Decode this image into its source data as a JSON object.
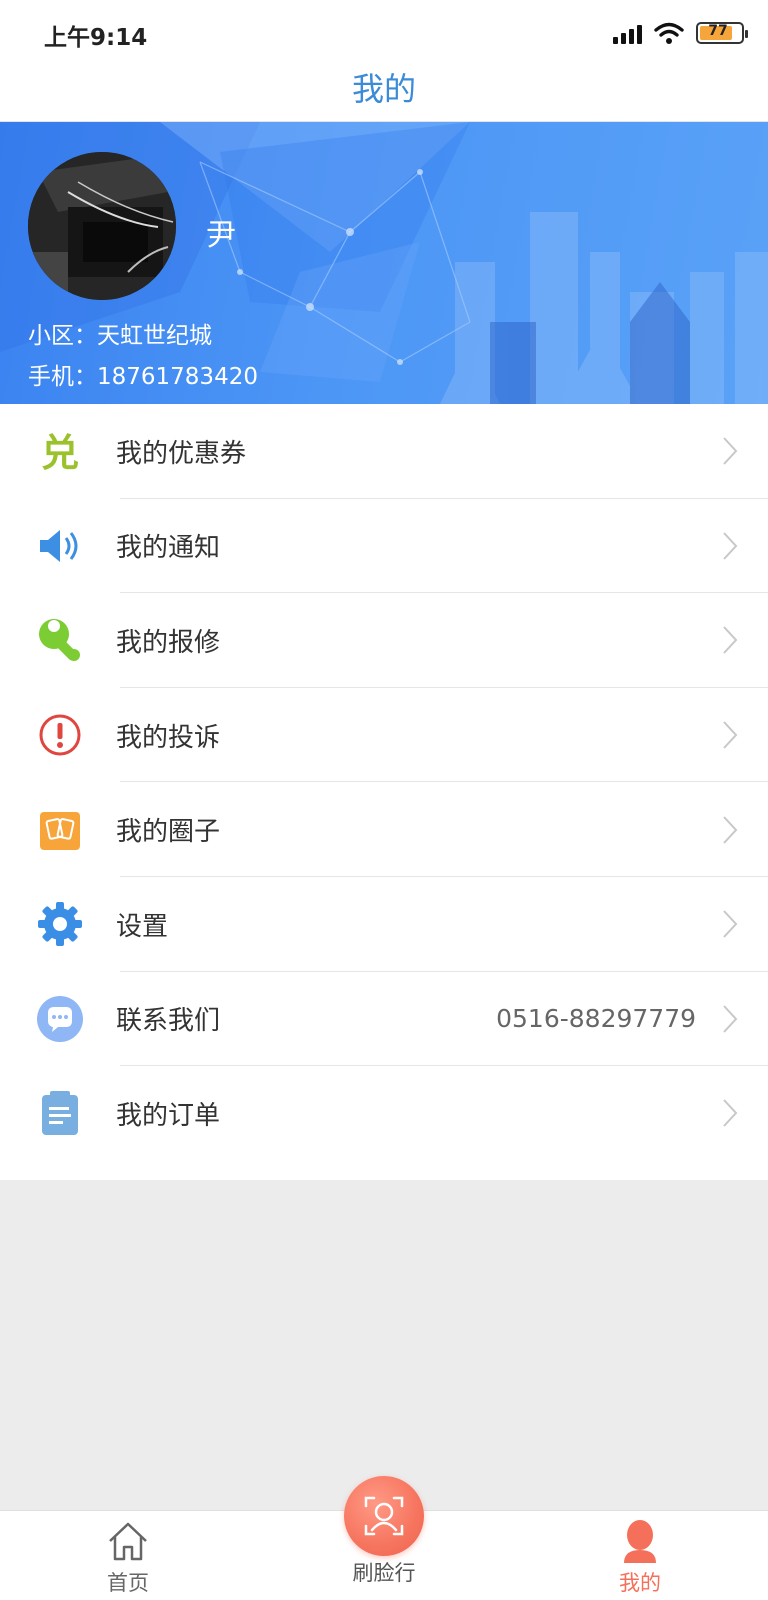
{
  "status_bar": {
    "time": "上午9:14",
    "battery": "77",
    "signal_icon": "signal-bars-icon",
    "wifi_icon": "wifi-icon"
  },
  "header": {
    "title": "我的"
  },
  "profile": {
    "name": "尹",
    "community": "小区：天虹世纪城",
    "phone": "手机：18761783420"
  },
  "menu": {
    "items": [
      {
        "label": "我的优惠券",
        "icon": "coupon-icon",
        "color": "#9bc22c"
      },
      {
        "label": "我的通知",
        "icon": "speaker-icon",
        "color": "#3d8fe4"
      },
      {
        "label": "我的报修",
        "icon": "wrench-icon",
        "color": "#7ccc33"
      },
      {
        "label": "我的投诉",
        "icon": "warning-icon",
        "color": "#e0463f"
      },
      {
        "label": "我的圈子",
        "icon": "cards-icon",
        "color": "#f7a43a"
      },
      {
        "label": "设置",
        "icon": "gear-icon",
        "color": "#3a8ee6"
      },
      {
        "label": "联系我们",
        "icon": "chat-bubble-icon",
        "color": "#8fb7f5",
        "value": "0516-88297779"
      },
      {
        "label": "我的订单",
        "icon": "clipboard-icon",
        "color": "#79aee0"
      }
    ]
  },
  "tab_bar": {
    "tabs": [
      {
        "label": "首页",
        "icon": "home-icon"
      },
      {
        "label": "刷脸行",
        "icon": "face-scan-icon"
      },
      {
        "label": "我的",
        "icon": "user-icon",
        "active": true
      }
    ],
    "accent_color": "#f5705a"
  }
}
